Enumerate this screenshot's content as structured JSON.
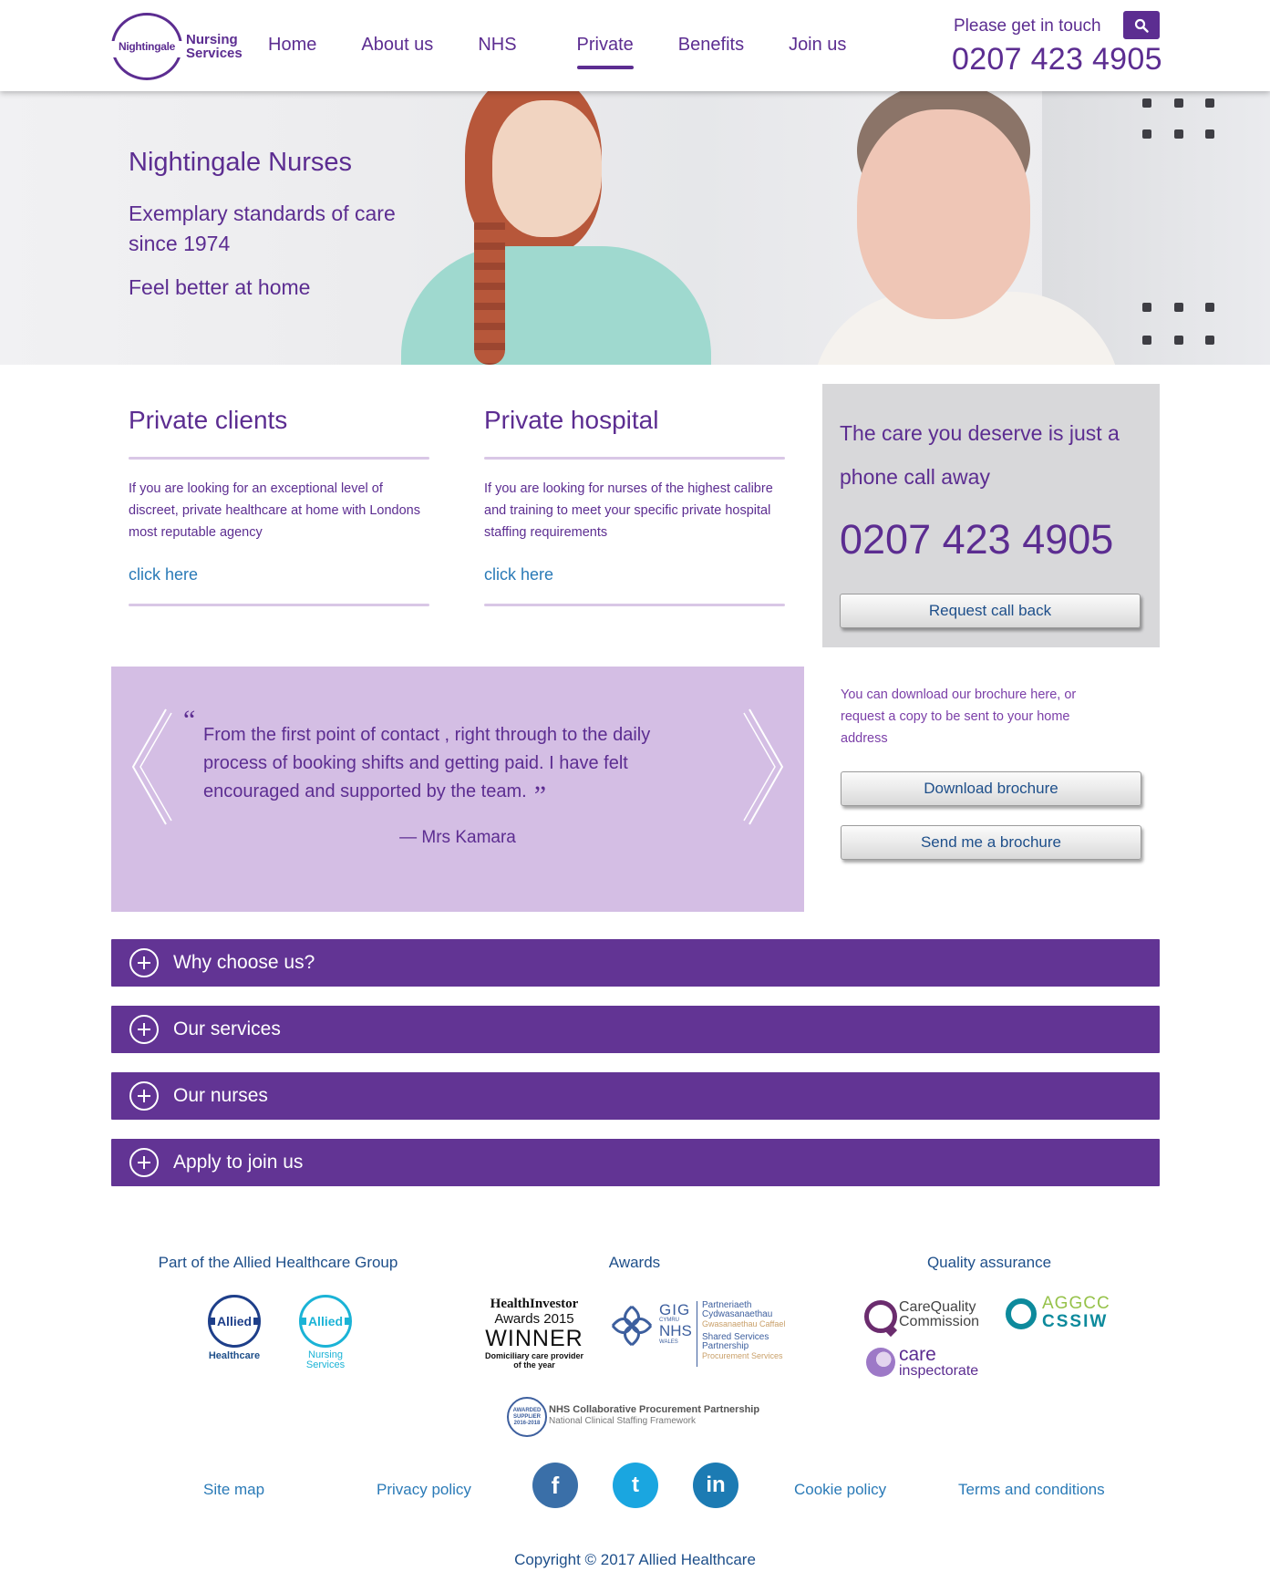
{
  "header": {
    "logo": {
      "oval_text": "Nightingale",
      "line1": "Nursing",
      "line2": "Services"
    },
    "nav": [
      "Home",
      "About us",
      "NHS",
      "Private",
      "Benefits",
      "Join us"
    ],
    "active_nav": "Private",
    "touch_label": "Please get in touch",
    "phone": "0207 423 4905",
    "search_icon": "search-icon"
  },
  "hero": {
    "title": "Nightingale Nurses",
    "subtitle": "Exemplary standards of care since 1974",
    "tagline": "Feel better at home"
  },
  "sections": [
    {
      "title": "Private clients",
      "text": "If you are looking for an exceptional level of discreet, private healthcare at home with Londons most reputable agency",
      "link": "click here"
    },
    {
      "title": "Private hospital",
      "text": "If you are looking for nurses of the highest calibre and training to meet your specific private hospital staffing requirements",
      "link": "click here"
    }
  ],
  "callbox": {
    "text": "The care you deserve is just a phone call away",
    "phone": "0207 423 4905",
    "button": "Request call back"
  },
  "testimonial": {
    "open_quote": "“",
    "text": "From the first point of contact , right through to the daily process of booking shifts and getting paid. I have felt encouraged and supported by the team.",
    "close_quote": "”",
    "author": "— Mrs Kamara"
  },
  "brochure": {
    "text": "You can download our brochure here, or request a copy to be sent to your home address",
    "download_button": "Download brochure",
    "send_button": "Send me a brochure"
  },
  "accordion": [
    "Why choose us?",
    "Our services",
    "Our nurses",
    "Apply to join us"
  ],
  "footer": {
    "group_heading": "Part of the Allied Healthcare Group",
    "awards_heading": "Awards",
    "quality_heading": "Quality assurance",
    "allied_logo": {
      "name": "Allied",
      "caption": "Healthcare"
    },
    "allied_nursing_logo": {
      "name": "Allied",
      "caption_line1": "Nursing",
      "caption_line2": "Services"
    },
    "award1": {
      "line1": "HealthInvestor",
      "line2": "Awards 2015",
      "line3": "WINNER",
      "line4": "Domiciliary care provider",
      "line5": "of the year"
    },
    "award2": {
      "gig": "GIG",
      "cymru": "CYMRU",
      "nhs": "NHS",
      "wales": "WALES",
      "line1": "Partneriaeth",
      "line2": "Cydwasanaethau",
      "line3": "Gwasanaethau Caffael",
      "line4": "Shared Services",
      "line5": "Partnership",
      "line6": "Procurement Services"
    },
    "award3": {
      "badge": "AWARDED SUPPLIER 2016-2018",
      "line1": "NHS Collaborative Procurement Partnership",
      "line2": "National Clinical Staffing Framework"
    },
    "cqc": {
      "line1": "CareQuality",
      "line2": "Commission"
    },
    "aggcc": {
      "line1": "AGGCC",
      "line2": "CSSIW"
    },
    "care_insp": {
      "line1": "care",
      "line2": "inspectorate"
    },
    "links": [
      "Site map",
      "Privacy policy",
      "Cookie policy",
      "Terms and conditions"
    ],
    "social": [
      {
        "icon": "facebook-icon",
        "glyph": "f",
        "color": "#3a6fa8"
      },
      {
        "icon": "twitter-icon",
        "glyph": "t",
        "color": "#1aa6e0"
      },
      {
        "icon": "linkedin-icon",
        "glyph": "in",
        "color": "#1c7bb3"
      }
    ],
    "copyright": "Copyright © 2017 Allied Healthcare"
  },
  "colors": {
    "brand_purple": "#5c2d91",
    "accordion_purple": "#623494",
    "testimonial_bg": "#d4bee4",
    "link_blue": "#2a7ab7"
  }
}
